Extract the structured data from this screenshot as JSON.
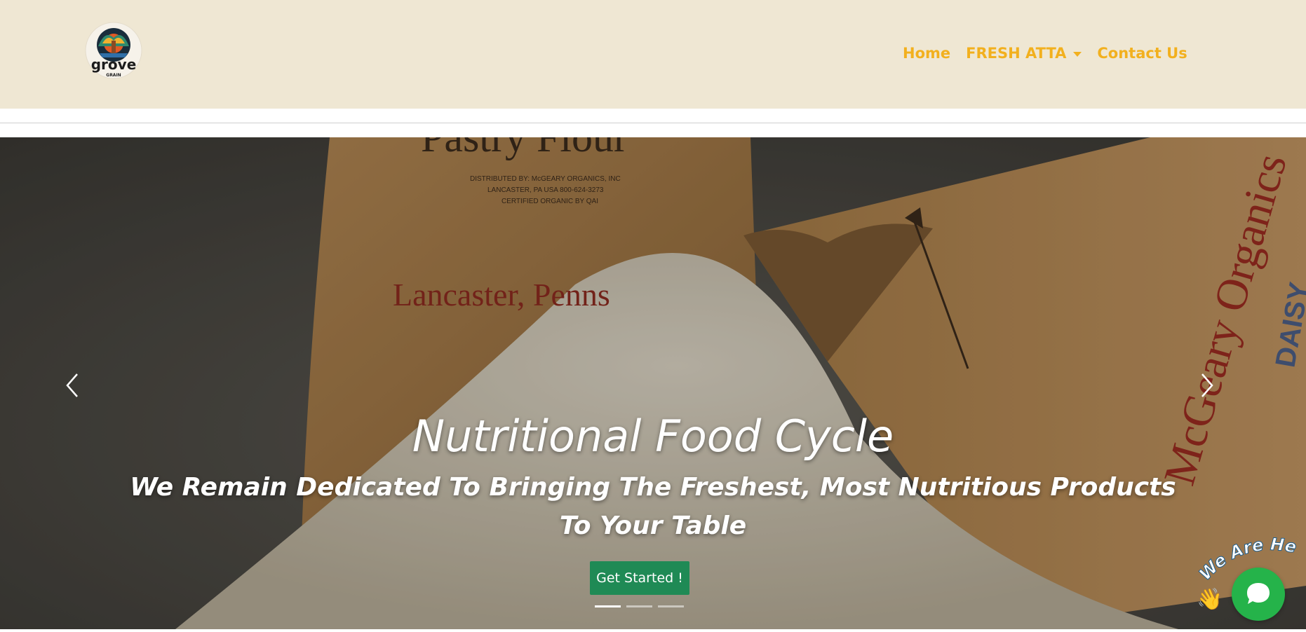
{
  "header": {
    "logo": {
      "icon": "grove-grain-logo",
      "name": "grove",
      "tagline": "GRAIN"
    },
    "nav": {
      "home": "Home",
      "fresh_atta": "FRESH ATTA",
      "contact": "Contact Us"
    }
  },
  "hero": {
    "title": "Nutritional Food Cycle",
    "subtitle_line1": "We Remain Dedicated To Bringing The Freshest, Most Nutritious Products",
    "subtitle_line2": "To Your Table",
    "cta_label": "Get Started !",
    "slides_total": 3,
    "active_slide": 1,
    "bag_text": {
      "bag1_top": "Pastry Flour",
      "bag1_line1": "DISTRIBUTED BY: McGEARY ORGANICS, INC",
      "bag1_line2": "LANCASTER, PA USA  800-624-3273",
      "bag1_line3": "CERTIFIED ORGANIC BY QAI",
      "bag1_place": "Lancaster, Penns",
      "bag2_brand": "McGeary Organics",
      "bag2_side": "DAISY"
    }
  },
  "chat_widget": {
    "label": "We Are Here!",
    "wave": "👋",
    "icon": "chat-bubble-icon"
  },
  "colors": {
    "header_bg": "#efe7d3",
    "nav_link": "#f2b01e",
    "cta_bg": "#1f8a55",
    "chat_bg": "#25b34a"
  }
}
